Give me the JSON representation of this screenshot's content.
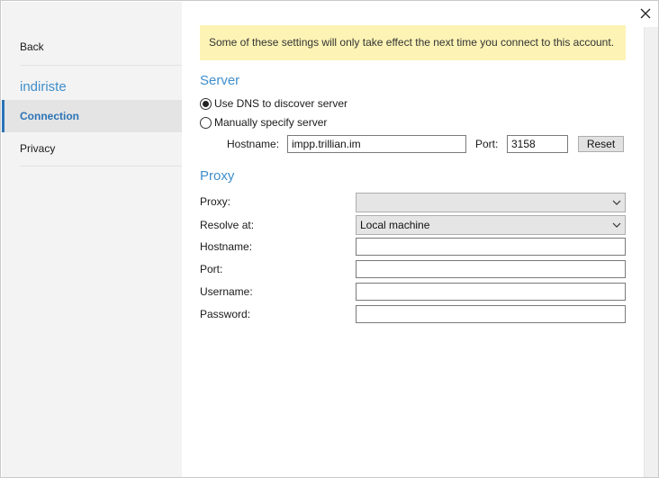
{
  "sidebar": {
    "back_label": "Back",
    "account_name": "indiriste",
    "items": [
      {
        "label": "Connection",
        "selected": true
      },
      {
        "label": "Privacy",
        "selected": false
      }
    ]
  },
  "notice": "Some of these settings will only take effect the next time you connect to this account.",
  "server": {
    "title": "Server",
    "option_dns": "Use DNS to discover server",
    "option_manual": "Manually specify server",
    "selected_option": "dns",
    "hostname_label": "Hostname:",
    "hostname_value": "impp.trillian.im",
    "port_label": "Port:",
    "port_value": "3158",
    "reset_label": "Reset"
  },
  "proxy": {
    "title": "Proxy",
    "proxy_label": "Proxy:",
    "proxy_value": "",
    "resolve_label": "Resolve at:",
    "resolve_value": "Local machine",
    "hostname_label": "Hostname:",
    "hostname_value": "",
    "port_label": "Port:",
    "port_value": "",
    "username_label": "Username:",
    "username_value": "",
    "password_label": "Password:",
    "password_value": ""
  },
  "icons": {
    "close": "close-icon",
    "dropdown": "chevron-down-icon"
  },
  "colors": {
    "accent": "#3f8ecb",
    "notice_bg": "#fcf3b5",
    "sidebar_bg": "#f3f3f3"
  }
}
